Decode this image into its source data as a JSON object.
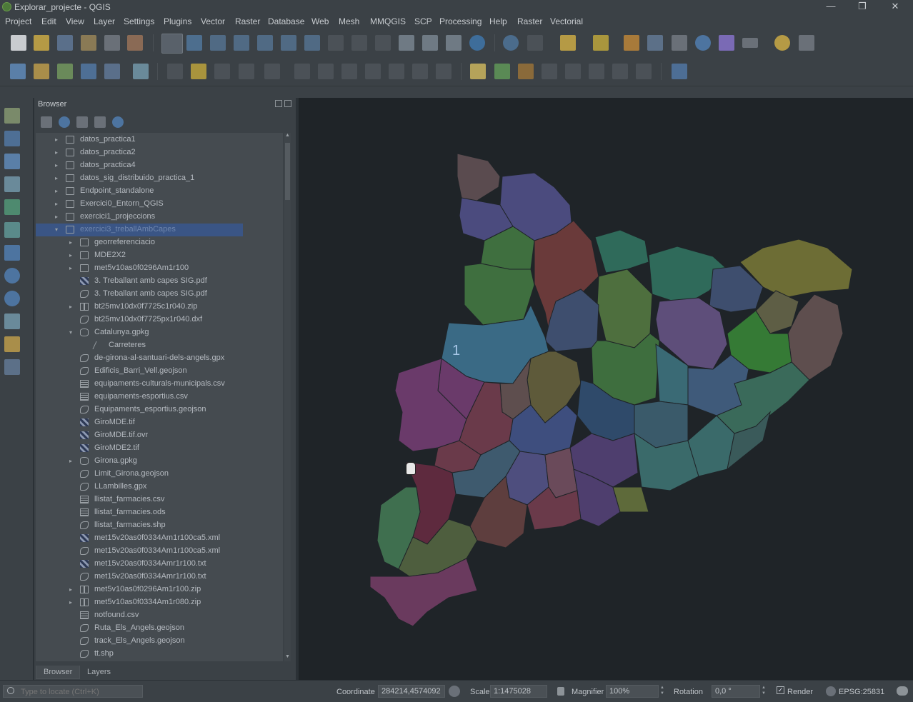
{
  "window": {
    "title": "Explorar_projecte - QGIS",
    "controls": {
      "minimize": "—",
      "maximize": "❐",
      "close": "✕"
    }
  },
  "menu": [
    "Project",
    "Edit",
    "View",
    "Layer",
    "Settings",
    "Plugins",
    "Vector",
    "Raster",
    "Database",
    "Web",
    "Mesh",
    "MMQGIS",
    "SCP",
    "Processing",
    "Help",
    "Raster",
    "Vectorial"
  ],
  "browser": {
    "title": "Browser",
    "items": [
      {
        "label": "datos_practica1",
        "type": "folder",
        "depth": 0,
        "arrow": "▸"
      },
      {
        "label": "datos_practica2",
        "type": "folder",
        "depth": 0,
        "arrow": "▸"
      },
      {
        "label": "datos_practica4",
        "type": "folder",
        "depth": 0,
        "arrow": "▸"
      },
      {
        "label": "datos_sig_distribuido_practica_1",
        "type": "folder",
        "depth": 0,
        "arrow": "▸"
      },
      {
        "label": "Endpoint_standalone",
        "type": "folder",
        "depth": 0,
        "arrow": "▸"
      },
      {
        "label": "Exercici0_Entorn_QGIS",
        "type": "folder",
        "depth": 0,
        "arrow": "▸"
      },
      {
        "label": "exercici1_projeccions",
        "type": "folder",
        "depth": 0,
        "arrow": "▸"
      },
      {
        "label": "exercici3_treballAmbCapes",
        "type": "folder",
        "depth": 0,
        "arrow": "▾",
        "selected": true
      },
      {
        "label": "georreferenciacio",
        "type": "folder",
        "depth": 1,
        "arrow": "▸"
      },
      {
        "label": "MDE2X2",
        "type": "folder",
        "depth": 1,
        "arrow": "▸"
      },
      {
        "label": "met5v10as0f0296Am1r100",
        "type": "folder",
        "depth": 1,
        "arrow": "▸"
      },
      {
        "label": "3. Treballant amb capes SIG.pdf",
        "type": "raster",
        "depth": 1,
        "arrow": ""
      },
      {
        "label": "3. Treballant amb capes SIG.pdf",
        "type": "vector",
        "depth": 1,
        "arrow": ""
      },
      {
        "label": "bt25mv10dx0f7725c1r040.zip",
        "type": "zip",
        "depth": 1,
        "arrow": "▸"
      },
      {
        "label": "bt25mv10dx0f7725px1r040.dxf",
        "type": "vector",
        "depth": 1,
        "arrow": ""
      },
      {
        "label": "Catalunya.gpkg",
        "type": "db",
        "depth": 1,
        "arrow": "▾"
      },
      {
        "label": "Carreteres",
        "type": "line",
        "depth": 2,
        "arrow": ""
      },
      {
        "label": "de-girona-al-santuari-dels-angels.gpx",
        "type": "vector",
        "depth": 1,
        "arrow": ""
      },
      {
        "label": "Edificis_Barri_Vell.geojson",
        "type": "vector",
        "depth": 1,
        "arrow": ""
      },
      {
        "label": "equipaments-culturals-municipals.csv",
        "type": "table",
        "depth": 1,
        "arrow": ""
      },
      {
        "label": "equipaments-esportius.csv",
        "type": "table",
        "depth": 1,
        "arrow": ""
      },
      {
        "label": "Equipaments_esportius.geojson",
        "type": "vector",
        "depth": 1,
        "arrow": ""
      },
      {
        "label": "GiroMDE.tif",
        "type": "raster",
        "depth": 1,
        "arrow": ""
      },
      {
        "label": "GiroMDE.tif.ovr",
        "type": "raster",
        "depth": 1,
        "arrow": ""
      },
      {
        "label": "GiroMDE2.tif",
        "type": "raster",
        "depth": 1,
        "arrow": ""
      },
      {
        "label": "Girona.gpkg",
        "type": "db",
        "depth": 1,
        "arrow": "▸"
      },
      {
        "label": "Limit_Girona.geojson",
        "type": "vector",
        "depth": 1,
        "arrow": ""
      },
      {
        "label": "LLambilles.gpx",
        "type": "vector",
        "depth": 1,
        "arrow": ""
      },
      {
        "label": "llistat_farmacies.csv",
        "type": "table",
        "depth": 1,
        "arrow": ""
      },
      {
        "label": "llistat_farmacies.ods",
        "type": "table",
        "depth": 1,
        "arrow": ""
      },
      {
        "label": "llistat_farmacies.shp",
        "type": "vector",
        "depth": 1,
        "arrow": ""
      },
      {
        "label": "met15v20as0f0334Am1r100ca5.xml",
        "type": "raster",
        "depth": 1,
        "arrow": ""
      },
      {
        "label": "met15v20as0f0334Am1r100ca5.xml",
        "type": "vector",
        "depth": 1,
        "arrow": ""
      },
      {
        "label": "met15v20as0f0334Amr1r100.txt",
        "type": "raster",
        "depth": 1,
        "arrow": ""
      },
      {
        "label": "met15v20as0f0334Amr1r100.txt",
        "type": "vector",
        "depth": 1,
        "arrow": ""
      },
      {
        "label": "met5v10as0f0296Am1r100.zip",
        "type": "zip",
        "depth": 1,
        "arrow": "▸"
      },
      {
        "label": "met5v10as0f0334Am1r080.zip",
        "type": "zip",
        "depth": 1,
        "arrow": "▸"
      },
      {
        "label": "notfound.csv",
        "type": "table",
        "depth": 1,
        "arrow": ""
      },
      {
        "label": "Ruta_Els_Angels.geojson",
        "type": "vector",
        "depth": 1,
        "arrow": ""
      },
      {
        "label": "track_Els_Angels.geojson",
        "type": "vector",
        "depth": 1,
        "arrow": ""
      },
      {
        "label": "tt.shp",
        "type": "vector",
        "depth": 1,
        "arrow": ""
      }
    ],
    "tabs": [
      "Browser",
      "Layers"
    ]
  },
  "map": {
    "label": "1"
  },
  "statusbar": {
    "locate_placeholder": "Type to locate (Ctrl+K)",
    "coordinate_label": "Coordinate",
    "coordinate_value": "284214,4574092",
    "scale_label": "Scale",
    "scale_value": "1:1475028",
    "magnifier_label": "Magnifier",
    "magnifier_value": "100%",
    "rotation_label": "Rotation",
    "rotation_value": "0,0 °",
    "render_label": "Render",
    "crs_value": "EPSG:25831"
  }
}
